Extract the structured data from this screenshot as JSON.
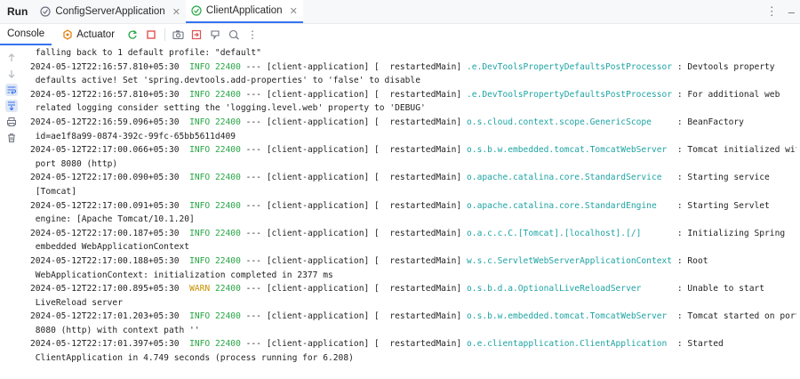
{
  "header": {
    "run_label": "Run",
    "tabs": [
      {
        "label": "ConfigServerApplication",
        "active": false
      },
      {
        "label": "ClientApplication",
        "active": true
      }
    ]
  },
  "toolbar": {
    "console_label": "Console",
    "actuator_label": "Actuator"
  },
  "console": {
    "lines": [
      {
        "text": " falling back to 1 default profile: \"default\""
      },
      {
        "ts": "2024-05-12T22:16:57.810+05:30",
        "level": "INFO",
        "pid": "22400",
        "mid": " --- [client-application] [  restartedMain] ",
        "logger": ".e.DevToolsPropertyDefaultsPostProcessor",
        "msg": " : Devtools property"
      },
      {
        "text": " defaults active! Set 'spring.devtools.add-properties' to 'false' to disable"
      },
      {
        "ts": "2024-05-12T22:16:57.810+05:30",
        "level": "INFO",
        "pid": "22400",
        "mid": " --- [client-application] [  restartedMain] ",
        "logger": ".e.DevToolsPropertyDefaultsPostProcessor",
        "msg": " : For additional web"
      },
      {
        "text": " related logging consider setting the 'logging.level.web' property to 'DEBUG'"
      },
      {
        "ts": "2024-05-12T22:16:59.096+05:30",
        "level": "INFO",
        "pid": "22400",
        "mid": " --- [client-application] [  restartedMain] ",
        "logger": "o.s.cloud.context.scope.GenericScope    ",
        "msg": " : BeanFactory"
      },
      {
        "text": " id=ae1f8a99-0874-392c-99fc-65bb5611d409"
      },
      {
        "ts": "2024-05-12T22:17:00.066+05:30",
        "level": "INFO",
        "pid": "22400",
        "mid": " --- [client-application] [  restartedMain] ",
        "logger": "o.s.b.w.embedded.tomcat.TomcatWebServer ",
        "msg": " : Tomcat initialized with"
      },
      {
        "text": " port 8080 (http)"
      },
      {
        "ts": "2024-05-12T22:17:00.090+05:30",
        "level": "INFO",
        "pid": "22400",
        "mid": " --- [client-application] [  restartedMain] ",
        "logger": "o.apache.catalina.core.StandardService  ",
        "msg": " : Starting service"
      },
      {
        "text": " [Tomcat]"
      },
      {
        "ts": "2024-05-12T22:17:00.091+05:30",
        "level": "INFO",
        "pid": "22400",
        "mid": " --- [client-application] [  restartedMain] ",
        "logger": "o.apache.catalina.core.StandardEngine   ",
        "msg": " : Starting Servlet"
      },
      {
        "text": " engine: [Apache Tomcat/10.1.20]"
      },
      {
        "ts": "2024-05-12T22:17:00.187+05:30",
        "level": "INFO",
        "pid": "22400",
        "mid": " --- [client-application] [  restartedMain] ",
        "logger": "o.a.c.c.C.[Tomcat].[localhost].[/]      ",
        "msg": " : Initializing Spring"
      },
      {
        "text": " embedded WebApplicationContext"
      },
      {
        "ts": "2024-05-12T22:17:00.188+05:30",
        "level": "INFO",
        "pid": "22400",
        "mid": " --- [client-application] [  restartedMain] ",
        "logger": "w.s.c.ServletWebServerApplicationContext",
        "msg": " : Root"
      },
      {
        "text": " WebApplicationContext: initialization completed in 2377 ms"
      },
      {
        "ts": "2024-05-12T22:17:00.895+05:30",
        "level": "WARN",
        "pid": "22400",
        "mid": " --- [client-application] [  restartedMain] ",
        "logger": "o.s.b.d.a.OptionalLiveReloadServer      ",
        "msg": " : Unable to start"
      },
      {
        "text": " LiveReload server"
      },
      {
        "ts": "2024-05-12T22:17:01.203+05:30",
        "level": "INFO",
        "pid": "22400",
        "mid": " --- [client-application] [  restartedMain] ",
        "logger": "o.s.b.w.embedded.tomcat.TomcatWebServer ",
        "msg": " : Tomcat started on port"
      },
      {
        "text": " 8080 (http) with context path ''"
      },
      {
        "ts": "2024-05-12T22:17:01.397+05:30",
        "level": "INFO",
        "pid": "22400",
        "mid": " --- [client-application] [  restartedMain] ",
        "logger": "o.e.clientapplication.ClientApplication ",
        "msg": " : Started"
      },
      {
        "text": " ClientApplication in 4.749 seconds (process running for 6.208)"
      }
    ]
  },
  "colors": {
    "accent": "#3574f0",
    "info": "#28a745",
    "warn": "#c79100",
    "logger": "#1fa3a3"
  }
}
